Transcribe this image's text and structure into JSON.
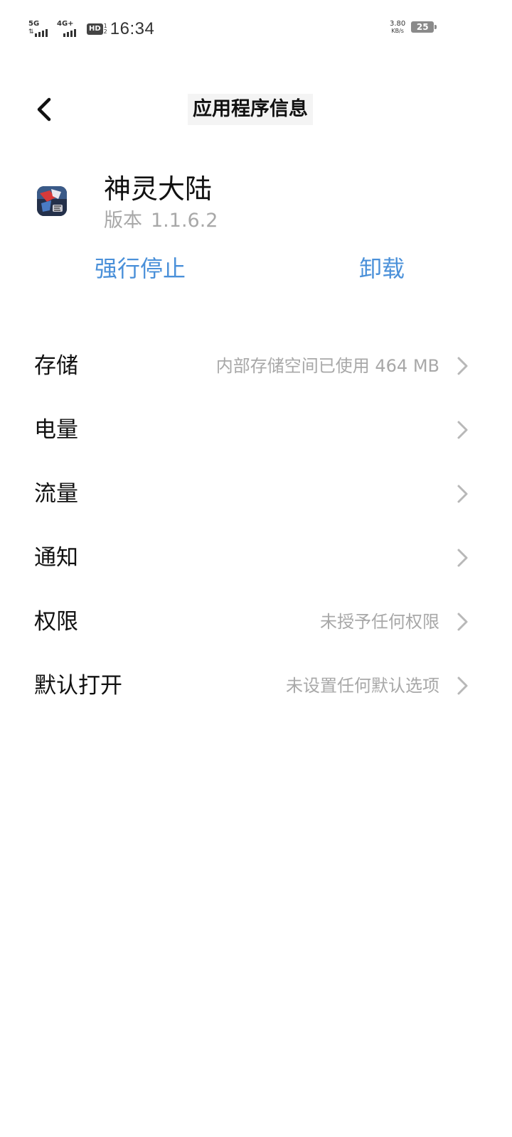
{
  "status_bar": {
    "sim1_network": "5G",
    "sim2_network": "4G+",
    "hd_label": "HD",
    "hd_sub_top": "1",
    "hd_sub_bottom": "2",
    "time": "16:34",
    "net_speed_value": "3.80",
    "net_speed_unit": "KB/s",
    "battery_level": "25"
  },
  "header": {
    "title": "应用程序信息"
  },
  "app": {
    "name": "神灵大陆",
    "version_label": "版本",
    "version_number": "1.1.6.2"
  },
  "actions": {
    "force_stop": "强行停止",
    "uninstall": "卸载"
  },
  "settings": [
    {
      "label": "存储",
      "value": "内部存储空间已使用  464  MB"
    },
    {
      "label": "电量",
      "value": ""
    },
    {
      "label": "流量",
      "value": ""
    },
    {
      "label": "通知",
      "value": ""
    },
    {
      "label": "权限",
      "value": "未授予任何权限"
    },
    {
      "label": "默认打开",
      "value": "未设置任何默认选项"
    }
  ],
  "colors": {
    "accent": "#4a90d9",
    "secondary_text": "#a8a8a8",
    "primary_text": "#111111",
    "title_highlight": "#f4f4f4"
  }
}
